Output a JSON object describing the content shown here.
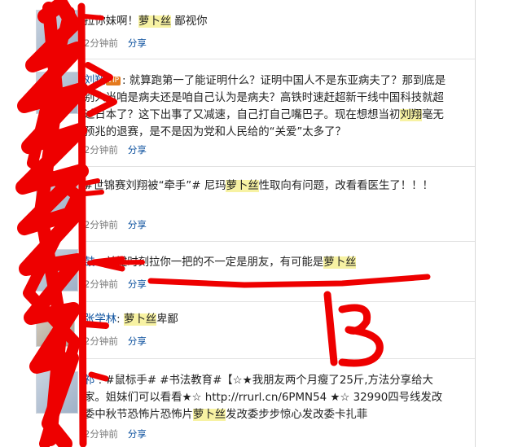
{
  "posts": [
    {
      "user": "",
      "segments": [
        "拉你妹啊！",
        "萝卜丝",
        " 鄙视你"
      ],
      "time": "2分钟前",
      "share": "分享"
    },
    {
      "user": "刘翔",
      "badge": "VIP",
      "segments": [
        "就算跑第一了能证明什么？证明中国人不是东亚病夫了？那到底是别人当咱是病夫还是咱自己认为是病夫？高铁时速赶超新干线中国科技就超过日本了？这下出事了又减速，自己打自己嘴巴子。现在想想当初",
        "刘翔",
        "毫无预兆的退赛，是不是因为党和人民给的“关爱”太多了？"
      ],
      "time": "2分钟前",
      "share": "分享"
    },
    {
      "user": "",
      "segments": [
        "#世锦赛刘翔被“牵手”# 尼玛",
        "萝卜丝",
        "性取向有问题，改看看医生了！！！"
      ],
      "time": "2分钟前",
      "share": "分享"
    },
    {
      "user": "鼓",
      "segments": [
        "关键时刻拉你一把的不一定是朋友，有可能是",
        "萝卜丝"
      ],
      "time": "2分钟前",
      "share": "分享"
    },
    {
      "user": "张学林",
      "segments": [
        "萝卜丝",
        "卑鄙"
      ],
      "time": "2分钟前",
      "share": "分享"
    },
    {
      "user": "祁",
      "segments": [
        "#鼠标手# #书法教育#【☆★我朋友两个月瘦了25斤,方法分享给大家。姐妹们可以看看★☆ http://rrurl.cn/6PMN54 ★☆ 32990四号线发改委中秋节恐怖片恐怖片",
        "萝卜丝",
        "发改委步步惊心发改委卡扎菲"
      ],
      "time": "2分钟前",
      "share": "分享"
    }
  ],
  "colors": {
    "scribble": "#ee0000",
    "link": "#0a4f9d",
    "highlight": "#f7f2a3"
  }
}
